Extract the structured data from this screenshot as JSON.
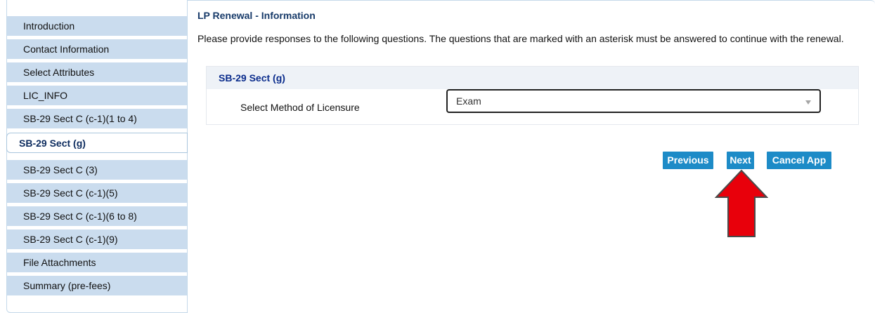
{
  "sidebar": {
    "items": [
      {
        "label": "Introduction",
        "active": false
      },
      {
        "label": "Contact Information",
        "active": false
      },
      {
        "label": "Select Attributes",
        "active": false
      },
      {
        "label": "LIC_INFO",
        "active": false
      },
      {
        "label": "SB-29 Sect C (c-1)(1 to 4)",
        "active": false
      },
      {
        "label": "SB-29 Sect (g)",
        "active": true
      },
      {
        "label": "SB-29 Sect C (3)",
        "active": false
      },
      {
        "label": "SB-29 Sect C (c-1)(5)",
        "active": false
      },
      {
        "label": "SB-29 Sect C (c-1)(6 to 8)",
        "active": false
      },
      {
        "label": "SB-29 Sect C (c-1)(9)",
        "active": false
      },
      {
        "label": "File Attachments",
        "active": false
      },
      {
        "label": "Summary (pre-fees)",
        "active": false
      }
    ]
  },
  "main": {
    "title": "LP Renewal - Information",
    "intro": "Please provide responses to the following questions. The questions that are marked with an asterisk must be answered to continue with the renewal.",
    "section_title": "SB-29 Sect (g)",
    "field": {
      "label": "Select Method of Licensure",
      "value": "Exam"
    },
    "buttons": {
      "previous": "Previous",
      "next": "Next",
      "cancel": "Cancel App"
    }
  },
  "colors": {
    "sidebar_bg": "#cadcee",
    "button_bg": "#1d8bc7",
    "annotation_arrow": "#e8000b"
  },
  "annotation": {
    "icon": "red-up-arrow-icon"
  }
}
